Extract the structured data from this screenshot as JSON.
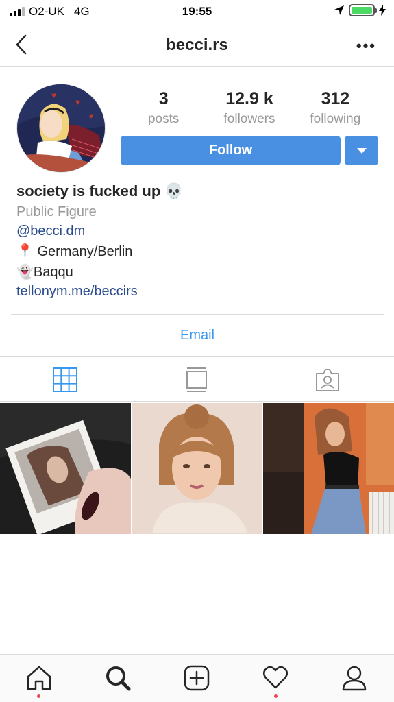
{
  "status_bar": {
    "carrier": "O2-UK",
    "network": "4G",
    "time": "19:55"
  },
  "header": {
    "username": "becci.rs",
    "more_label": "•••"
  },
  "profile": {
    "stats": [
      {
        "value": "3",
        "label": "posts"
      },
      {
        "value": "12.9 k",
        "label": "followers"
      },
      {
        "value": "312",
        "label": "following"
      }
    ],
    "follow_label": "Follow",
    "name": "society is fucked up 💀",
    "category": "Public Figure",
    "bio_lines": [
      "@becci.dm",
      "📍 Germany/Berlin",
      "👻Baqqu",
      "tellonym.me/beccirs"
    ],
    "email_label": "Email"
  },
  "tabs": [
    "grid-icon",
    "feed-icon",
    "tagged-icon"
  ],
  "nav": [
    "home-icon",
    "search-icon",
    "add-icon",
    "heart-icon",
    "profile-icon"
  ],
  "colors": {
    "accent": "#4a90e2",
    "link": "#3897f0",
    "notification": "#ed4956"
  }
}
